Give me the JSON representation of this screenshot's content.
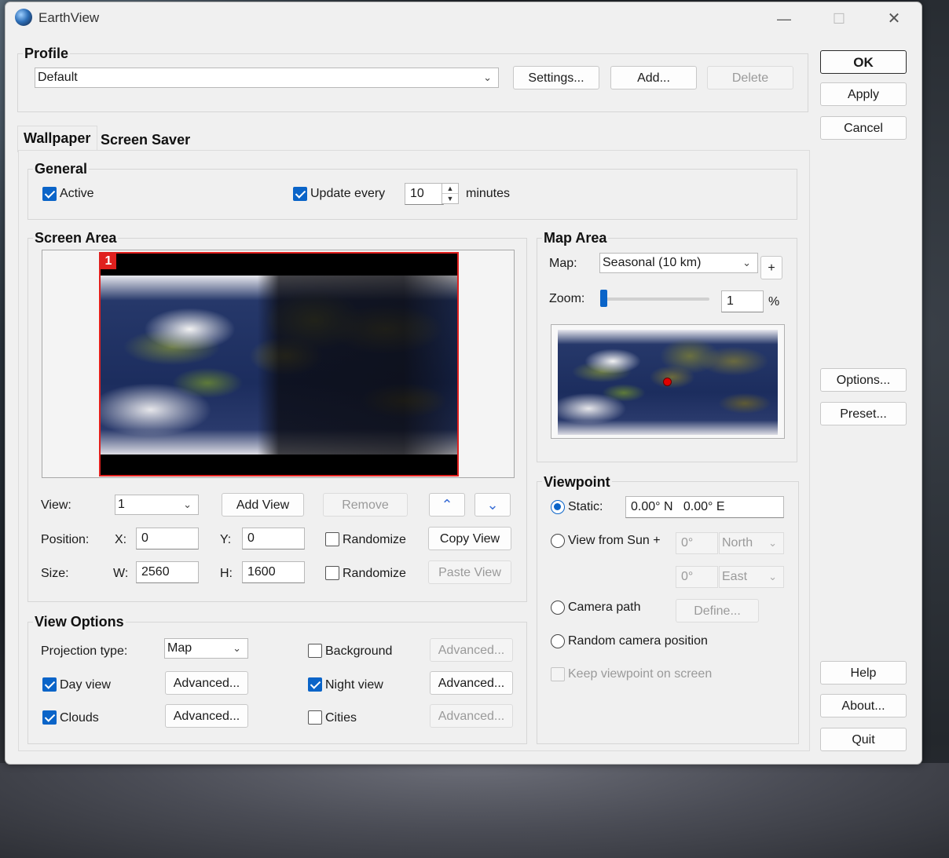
{
  "window": {
    "title": "EarthView",
    "controls": [
      "—",
      "☐",
      "✕"
    ]
  },
  "profile": {
    "group_label": "Profile",
    "selected": "Default",
    "settings_label": "Settings...",
    "add_label": "Add...",
    "delete_label": "Delete"
  },
  "side_buttons": {
    "ok": "OK",
    "apply": "Apply",
    "cancel": "Cancel",
    "options": "Options...",
    "preset": "Preset...",
    "help": "Help",
    "about": "About...",
    "quit": "Quit"
  },
  "tabs": [
    {
      "label": "Wallpaper",
      "active": true
    },
    {
      "label": "Screen Saver",
      "active": false
    }
  ],
  "general": {
    "group_label": "General",
    "active_label": "Active",
    "active_checked": true,
    "update_label": "Update every",
    "update_checked": true,
    "update_value": "10",
    "minutes_label": "minutes"
  },
  "screen_area": {
    "group_label": "Screen Area",
    "monitor_number": "1",
    "view_label": "View:",
    "view_value": "1",
    "add_view_label": "Add View",
    "remove_label": "Remove",
    "position_label": "Position:",
    "x_label": "X:",
    "x_value": "0",
    "y_label": "Y:",
    "y_value": "0",
    "randomize_label": "Randomize",
    "copy_view_label": "Copy View",
    "size_label": "Size:",
    "w_label": "W:",
    "w_value": "2560",
    "h_label": "H:",
    "h_value": "1600",
    "randomize2_label": "Randomize",
    "paste_view_label": "Paste View"
  },
  "view_options": {
    "group_label": "View Options",
    "projection_label": "Projection type:",
    "projection_value": "Map",
    "background_label": "Background",
    "background_checked": false,
    "advanced_label": "Advanced...",
    "day_view_label": "Day view",
    "day_view_checked": true,
    "night_view_label": "Night view",
    "night_view_checked": true,
    "clouds_label": "Clouds",
    "clouds_checked": true,
    "cities_label": "Cities",
    "cities_checked": false
  },
  "map_area": {
    "group_label": "Map Area",
    "map_label": "Map:",
    "map_value": "Seasonal (10 km)",
    "plus_label": "+",
    "zoom_label": "Zoom:",
    "zoom_value": "1",
    "zoom_unit": "%"
  },
  "viewpoint": {
    "group_label": "Viewpoint",
    "static_label": "Static:",
    "static_value": "0.00° N   0.00° E",
    "sun_label": "View from Sun +",
    "sun_deg1": "0°",
    "sun_dir1": "North",
    "sun_deg2": "0°",
    "sun_dir2": "East",
    "camera_path_label": "Camera path",
    "define_label": "Define...",
    "random_camera_label": "Random camera position",
    "keep_label": "Keep viewpoint on screen"
  }
}
